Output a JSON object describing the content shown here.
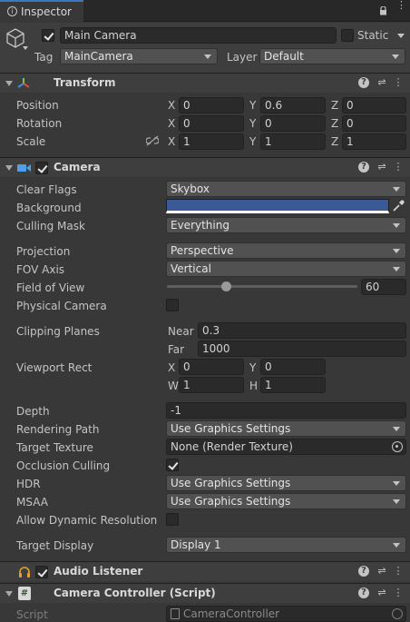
{
  "tab": {
    "label": "Inspector"
  },
  "object": {
    "name": "Main Camera",
    "static_label": "Static",
    "tag_label": "Tag",
    "tag_value": "MainCamera",
    "layer_label": "Layer",
    "layer_value": "Default"
  },
  "transform": {
    "title": "Transform",
    "position": {
      "label": "Position",
      "x": "0",
      "y": "0.6",
      "z": "0"
    },
    "rotation": {
      "label": "Rotation",
      "x": "0",
      "y": "0",
      "z": "0"
    },
    "scale": {
      "label": "Scale",
      "x": "1",
      "y": "1",
      "z": "1"
    },
    "axes": {
      "x": "X",
      "y": "Y",
      "z": "Z"
    }
  },
  "camera": {
    "title": "Camera",
    "clear_flags": {
      "label": "Clear Flags",
      "value": "Skybox"
    },
    "background": {
      "label": "Background",
      "color": "#3a5a95"
    },
    "culling_mask": {
      "label": "Culling Mask",
      "value": "Everything"
    },
    "projection": {
      "label": "Projection",
      "value": "Perspective"
    },
    "fov_axis": {
      "label": "FOV Axis",
      "value": "Vertical"
    },
    "field_of_view": {
      "label": "Field of View",
      "value": "60",
      "slider_fraction": 0.31
    },
    "physical_camera": {
      "label": "Physical Camera",
      "checked": false
    },
    "clipping_planes": {
      "label": "Clipping Planes",
      "near_label": "Near",
      "near": "0.3",
      "far_label": "Far",
      "far": "1000"
    },
    "viewport_rect": {
      "label": "Viewport Rect",
      "x_label": "X",
      "x": "0",
      "y_label": "Y",
      "y": "0",
      "w_label": "W",
      "w": "1",
      "h_label": "H",
      "h": "1"
    },
    "depth": {
      "label": "Depth",
      "value": "-1"
    },
    "rendering_path": {
      "label": "Rendering Path",
      "value": "Use Graphics Settings"
    },
    "target_texture": {
      "label": "Target Texture",
      "value": "None (Render Texture)"
    },
    "occlusion_culling": {
      "label": "Occlusion Culling",
      "checked": true
    },
    "hdr": {
      "label": "HDR",
      "value": "Use Graphics Settings"
    },
    "msaa": {
      "label": "MSAA",
      "value": "Use Graphics Settings"
    },
    "allow_dynamic_resolution": {
      "label": "Allow Dynamic Resolution",
      "checked": false
    },
    "target_display": {
      "label": "Target Display",
      "value": "Display 1"
    }
  },
  "audio_listener": {
    "title": "Audio Listener"
  },
  "camera_controller": {
    "title": "Camera Controller (Script)",
    "script_label": "Script",
    "script_value": "CameraController"
  },
  "colors": {
    "panel": "#383838",
    "header": "#3e3e3e",
    "field": "#2a2a2a",
    "dropdown": "#515151",
    "accent_blue": "#3a79bb"
  }
}
